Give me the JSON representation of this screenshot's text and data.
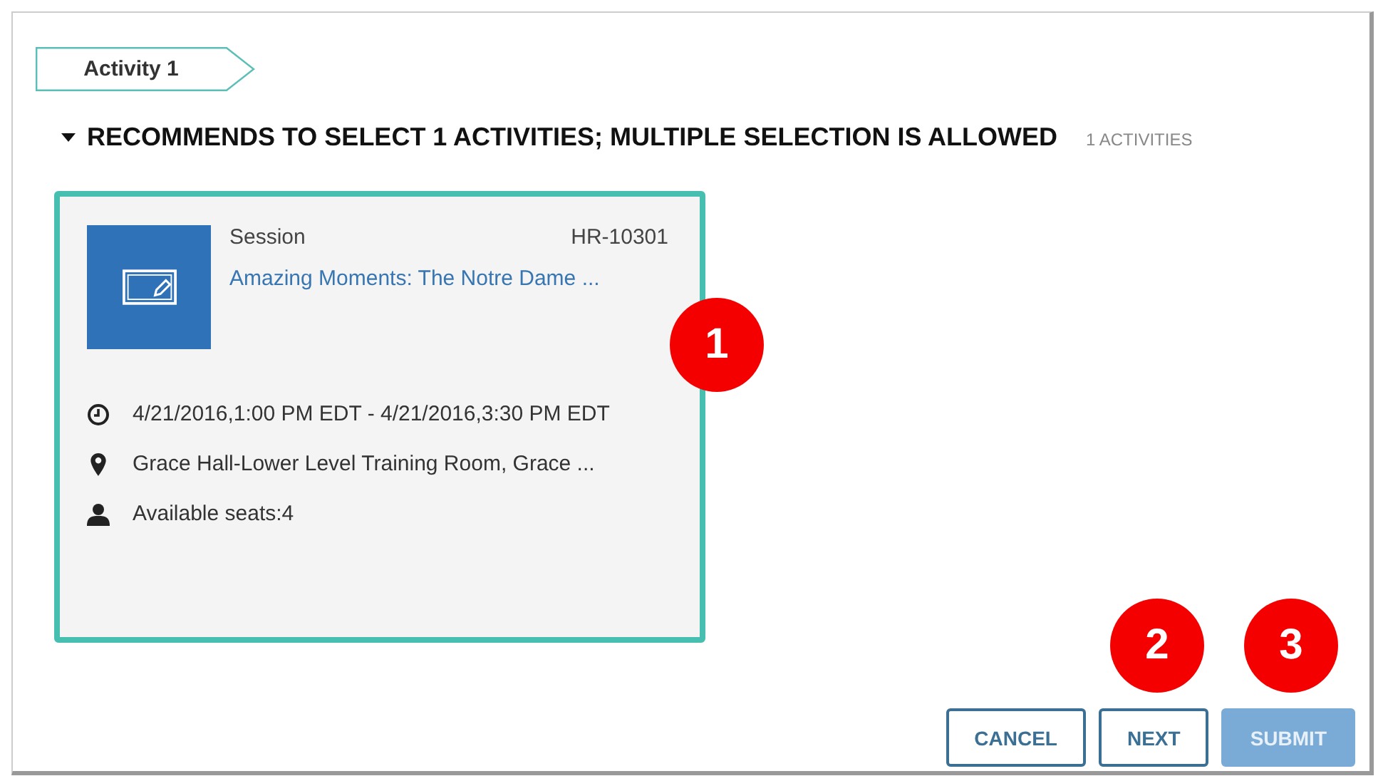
{
  "step_tab": {
    "label": "Activity 1"
  },
  "section": {
    "expanded": true,
    "heading": "RECOMMENDS TO SELECT 1 ACTIVITIES; MULTIPLE SELECTION IS ALLOWED",
    "count": "1 ACTIVITIES"
  },
  "activities": [
    {
      "selected": true,
      "type": "Session",
      "code": "HR-10301",
      "title": "Amazing Moments: The Notre Dame ...",
      "datetime": "4/21/2016,1:00 PM EDT - 4/21/2016,3:30 PM EDT",
      "location": "Grace Hall-Lower Level Training Room, Grace ...",
      "seats": "Available seats:4"
    }
  ],
  "buttons": [
    {
      "label": "CANCEL",
      "disabled": false,
      "kind": "outline"
    },
    {
      "label": "NEXT",
      "disabled": false,
      "kind": "outline"
    },
    {
      "label": "SUBMIT",
      "disabled": true,
      "kind": "primary"
    }
  ],
  "callouts": [
    "1",
    "2",
    "3"
  ]
}
